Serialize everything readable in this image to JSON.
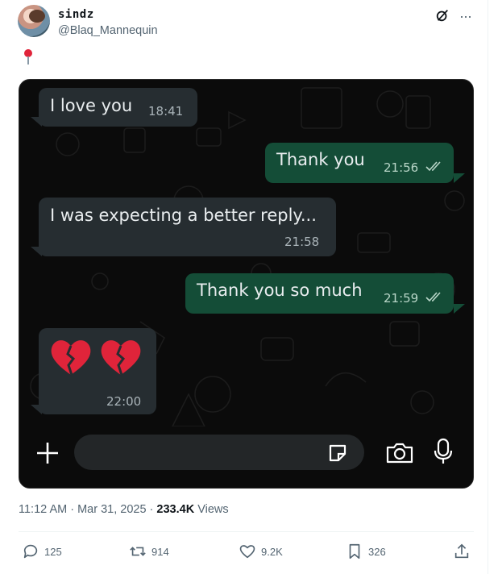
{
  "tweet": {
    "display_name": "sindz",
    "handle": "@Blaq_Mannequin",
    "icons": {
      "grok": "grok-icon",
      "more": "more-icon",
      "pin": "round-pushpin-icon"
    },
    "more_label": "···",
    "timestamp": "11:12 AM · Mar 31, 2025 · ",
    "views_count": "233.4K",
    "views_label": " Views",
    "actions": {
      "replies": "125",
      "reposts": "914",
      "likes": "9.2K",
      "bookmarks": "326"
    }
  },
  "chat": {
    "messages": [
      {
        "direction": "incoming",
        "text": "I love you",
        "time": "18:41"
      },
      {
        "direction": "outgoing",
        "text": "Thank you",
        "time": "21:56",
        "status": "read"
      },
      {
        "direction": "incoming",
        "text": "I was expecting a better reply...",
        "time": "21:58"
      },
      {
        "direction": "outgoing",
        "text": "Thank you so much",
        "time": "21:59",
        "status": "read"
      },
      {
        "direction": "incoming",
        "text": "",
        "emoji": "broken-heart x2",
        "time": "22:00"
      }
    ],
    "composer": {
      "placeholder": "",
      "icons": [
        "plus-icon",
        "sticker-icon",
        "camera-icon",
        "microphone-icon"
      ]
    }
  },
  "colors": {
    "incoming_bubble": "#262d31",
    "outgoing_bubble": "#144d37",
    "chat_background": "#0b0b0b",
    "heart_red": "#e0243a"
  }
}
